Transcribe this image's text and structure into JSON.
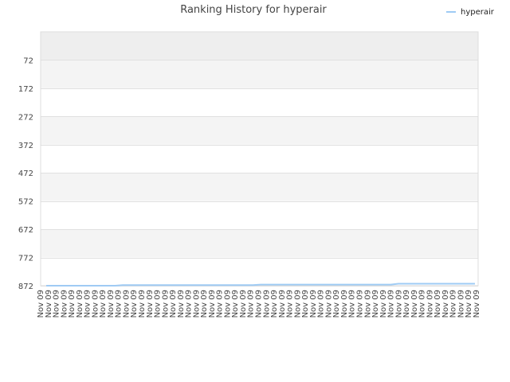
{
  "chart_data": {
    "type": "line",
    "title": "Ranking History for hyperair",
    "xlabel": "",
    "ylabel": "",
    "y_reversed": true,
    "ylim": [
      872,
      -28
    ],
    "yticks": [
      72,
      172,
      272,
      372,
      472,
      572,
      672,
      772,
      872
    ],
    "x": [
      "Nov 09",
      "Nov 09",
      "Nov 09",
      "Nov 09",
      "Nov 09",
      "Nov 09",
      "Nov 09",
      "Nov 09",
      "Nov 09",
      "Nov 09",
      "Nov 09",
      "Nov 09",
      "Nov 09",
      "Nov 09",
      "Nov 09",
      "Nov 09",
      "Nov 09",
      "Nov 09",
      "Nov 09",
      "Nov 09",
      "Nov 09",
      "Nov 09",
      "Nov 09",
      "Nov 09",
      "Nov 09",
      "Nov 09",
      "Nov 09",
      "Nov 09",
      "Nov 09",
      "Nov 09",
      "Nov 09",
      "Nov 09",
      "Nov 09",
      "Nov 09",
      "Nov 09",
      "Nov 09",
      "Nov 09",
      "Nov 09",
      "Nov 09",
      "Nov 09",
      "Nov 09",
      "Nov 09",
      "Nov 09",
      "Nov 09",
      "Nov 09",
      "Nov 09",
      "Nov 09",
      "Nov 09",
      "Nov 09",
      "Nov 09",
      "Nov 09",
      "Nov 09",
      "Nov 09",
      "Nov 09",
      "Nov 09",
      "Nov 09",
      "Nov 09"
    ],
    "series": [
      {
        "name": "hyperair",
        "color": "#9fcbf4",
        "values": [
          872,
          872,
          872,
          872,
          872,
          872,
          872,
          872,
          872,
          872,
          870,
          870,
          870,
          870,
          870,
          870,
          870,
          870,
          870,
          870,
          870,
          870,
          870,
          870,
          870,
          870,
          870,
          870,
          868,
          868,
          868,
          868,
          868,
          868,
          868,
          868,
          868,
          868,
          868,
          868,
          868,
          868,
          868,
          868,
          868,
          868,
          865,
          865,
          865,
          865,
          865,
          865,
          865,
          865,
          865,
          865,
          865
        ]
      }
    ],
    "grid": true,
    "band_colors": [
      "#eeeeee",
      "#f4f4f4",
      "#ffffff"
    ],
    "legend_position": "top-right"
  }
}
